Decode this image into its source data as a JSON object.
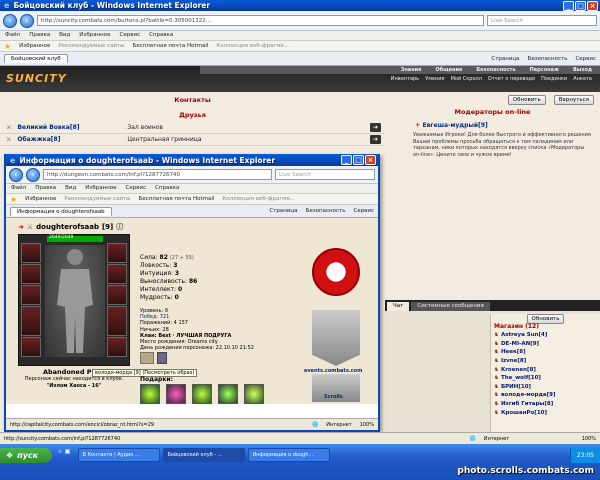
{
  "outer": {
    "title": "Бойцовский клуб - Windows Internet Explorer",
    "url": "http://suncity.combats.com/buttons.pl?battle=0.305001322...",
    "search_placeholder": "Live Search",
    "menu": [
      "Файл",
      "Правка",
      "Вид",
      "Избранное",
      "Сервис",
      "Справка"
    ],
    "favorites": [
      "Избранное",
      "Рекомендуемые сайты",
      "Бесплатная почта Hotmail",
      "Коллекция веб-фрагме..."
    ],
    "tab": "Бойцовский клуб",
    "tools": [
      "Страница",
      "Безопасность",
      "Сервис"
    ]
  },
  "game": {
    "logo": "SUNCITY",
    "nav1": [
      "Знания",
      "Общение",
      "Безопасность",
      "Персонаж",
      "Выход"
    ],
    "nav2": [
      "Инвентарь",
      "Умения",
      "Мой Скролл",
      "Отчет о переводе",
      "Поединки",
      "Анкета"
    ],
    "contacts_title": "Контакты",
    "friends_title": "Друзья",
    "friends": [
      {
        "name": "Великий Вовка",
        "level": "[8]",
        "location": "Зал воинов"
      },
      {
        "name": "Обажжка",
        "level": "[8]",
        "location": "Центральная гринница"
      }
    ],
    "moderators_title": "Модераторы on-line",
    "refresh_btn": "Обновить",
    "back_btn": "Вернуться",
    "moderator": {
      "name": "Евгеша-мудрый",
      "level": "[9]"
    },
    "notice": "Уважаемые Игроки! Для более быстрого и эффективного решения Вашей проблемы просьба обращаться к тем паладинам или тарханам, ники которых находятся вверху списка «Модераторы on-line». Цените свое и чужое время!",
    "chat_tabs": [
      "Чат",
      "Системные сообщения"
    ],
    "chat_refresh": "Обновить",
    "shop_title": "Магазин (12)",
    "chat_users": [
      "Astreya Sun[4]",
      "DE-MI-AN[9]",
      "Неек[8]",
      "Izvne[8]",
      "Kroenen[8]",
      "The_wolf[10]",
      "БРИН[10]",
      "володя-морда[9]",
      "Изгиб Гитары[8]",
      "КрошанРо[10]"
    ]
  },
  "popup": {
    "title": "Информация о doughterofsaab - Windows Internet Explorer",
    "url": "http://dungeon.combats.com/inf.pl?1287726740",
    "search_placeholder": "Live Search",
    "menu": [
      "Файл",
      "Правка",
      "Вид",
      "Избранное",
      "Сервис",
      "Справка"
    ],
    "favorites": [
      "Избранное",
      "Рекомендуемые сайты",
      "Бесплатная почта Hotmail",
      "Коллекция веб-фрагме..."
    ],
    "tab": "Информация о doughterofsaab",
    "tools": [
      "Страница",
      "Безопасность",
      "Сервис"
    ],
    "char_name": "doughterofsaab",
    "char_level": "[9]",
    "hp": "2049/2049",
    "stats": [
      {
        "k": "Сила:",
        "v": "82",
        "extra": "(27 + 55)"
      },
      {
        "k": "Ловкость:",
        "v": "3",
        "extra": ""
      },
      {
        "k": "Интуиция:",
        "v": "3",
        "extra": ""
      },
      {
        "k": "Выносливость:",
        "v": "86",
        "extra": ""
      },
      {
        "k": "Интеллект:",
        "v": "0",
        "extra": ""
      },
      {
        "k": "Мудрость:",
        "v": "0",
        "extra": ""
      }
    ],
    "info": [
      "Уровень: 9",
      "Побед: 721",
      "Поражений: 4 157",
      "Ничьих: 28",
      "Клан: Best · ЛУЧШАЯ ПОДРУГА",
      "Место рождения: Dreams city",
      "День рождения персонажа: 22.10.10 21:52"
    ],
    "location": "Abandoned Plain",
    "location_note": "Персонаж сейчас находится в клубе.",
    "location_room": "\"Излом Хаоса - 16\"",
    "tooltip": "володя-морда [9] (Посмотреть образ)",
    "gifts_title": "Подарки:",
    "events_label": "events.combats.com",
    "scrolls_label": "Scrolls",
    "status_url": "http://capitalcity.combats.com/encicl/obraz_nt.html?s=29",
    "status_zone": "Интернет",
    "status_zoom": "100%"
  },
  "outer_status": {
    "url": "http://suncity.combats.com/inf.pl?1287726740",
    "zone": "Интернет",
    "zoom": "100%"
  },
  "taskbar": {
    "start": "пуск",
    "tasks": [
      "В Контакте | Аудио ...",
      "Бойцовский клуб - ...",
      "Информация о dough..."
    ],
    "clock": "23:05"
  },
  "watermark": "photo.scrolls.combats.com",
  "colors": {
    "xp_blue": "#0848b8",
    "taskbar_blue": "#2058c8",
    "brand_red": "#a00000",
    "start_green": "#2e8c2e"
  }
}
